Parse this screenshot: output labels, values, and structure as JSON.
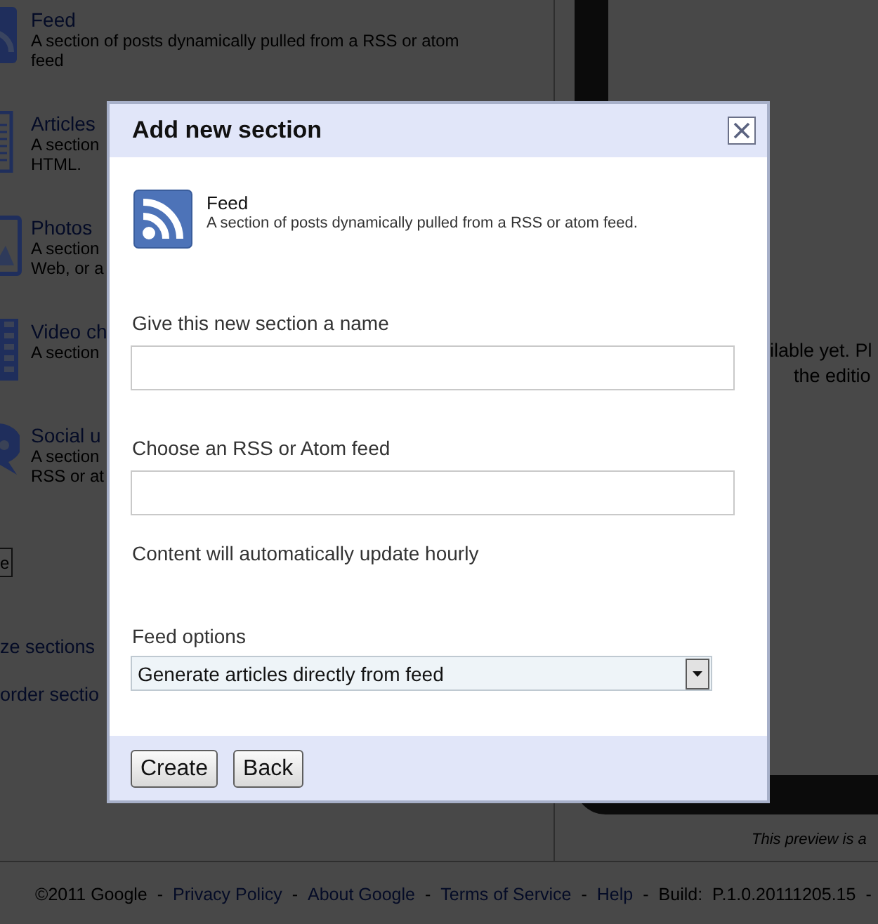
{
  "background_page": {
    "section_types": [
      {
        "kind": "feed",
        "title": "Feed",
        "description_lines": [
          "A section of posts dynamically pulled from a RSS or atom",
          "feed"
        ]
      },
      {
        "kind": "articles",
        "title": "Articles",
        "description_lines": [
          "A section",
          "HTML."
        ]
      },
      {
        "kind": "photos",
        "title": "Photos",
        "description_lines": [
          "A section",
          "Web, or a"
        ]
      },
      {
        "kind": "video",
        "title": "Video ch",
        "description_lines": [
          "A section"
        ]
      },
      {
        "kind": "social",
        "title": "Social u",
        "description_lines": [
          "A section",
          "RSS or at"
        ]
      }
    ],
    "button": "e",
    "links": [
      "ze sections",
      "order sectio"
    ],
    "preview_lines": [
      "ilable yet. Pl",
      "the editio"
    ],
    "preview_note": "This preview is a"
  },
  "dialog": {
    "title": "Add new section",
    "section_type": {
      "kind": "feed",
      "title": "Feed",
      "description": "A section of posts dynamically pulled from a RSS or atom feed."
    },
    "fields": [
      {
        "label": "Give this new section a name"
      },
      {
        "label": "Choose an RSS or Atom feed"
      }
    ],
    "note": "Content will automatically update hourly",
    "feed_options": {
      "label": "Feed options",
      "value": "Generate articles directly from feed"
    },
    "buttons": [
      "Create",
      "Back"
    ]
  },
  "footer": [
    {
      "kind": "text",
      "text": "©2011 Google"
    },
    {
      "kind": "separator",
      "text": "-"
    },
    {
      "kind": "link",
      "text": "Privacy Policy"
    },
    {
      "kind": "separator",
      "text": "-"
    },
    {
      "kind": "link",
      "text": "About Google"
    },
    {
      "kind": "separator",
      "text": "-"
    },
    {
      "kind": "link",
      "text": "Terms of Service"
    },
    {
      "kind": "separator",
      "text": "-"
    },
    {
      "kind": "link",
      "text": "Help"
    },
    {
      "kind": "separator",
      "text": "-"
    },
    {
      "kind": "text",
      "text": "Build:  P.1.0.20111205.15"
    },
    {
      "kind": "separator",
      "text": "-"
    }
  ]
}
